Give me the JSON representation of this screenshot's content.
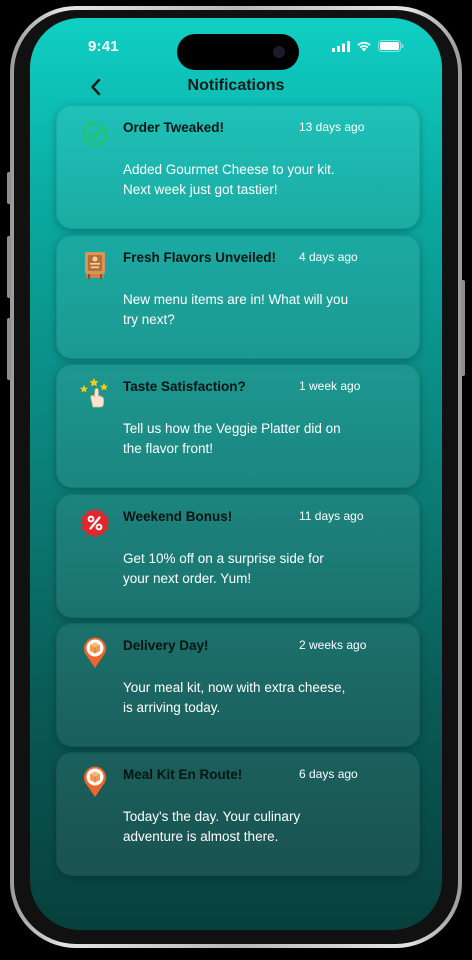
{
  "status_bar": {
    "time": "9:41"
  },
  "header": {
    "title": "Notifications"
  },
  "notifications": [
    {
      "title": "Order Tweaked!",
      "time": "13 days ago",
      "body": "Added Gourmet Cheese to your kit. Next week just got tastier!",
      "icon": "check-circle-icon"
    },
    {
      "title": "Fresh Flavors Unveiled!",
      "time": "4 days ago",
      "body": "New menu items are in! What will you try next?",
      "icon": "menu-board-icon"
    },
    {
      "title": "Taste Satisfaction?",
      "time": "1 week ago",
      "body": "Tell us how the Veggie Platter did on the flavor front!",
      "icon": "stars-rating-icon"
    },
    {
      "title": "Weekend Bonus!",
      "time": "11 days ago",
      "body": "Get 10% off on a surprise side for your next order. Yum!",
      "icon": "discount-badge-icon"
    },
    {
      "title": "Delivery Day!",
      "time": "2 weeks ago",
      "body": "Your meal kit, now with extra cheese, is arriving today.",
      "icon": "delivery-pin-icon"
    },
    {
      "title": "Meal Kit En Route!",
      "time": "6 days ago",
      "body": "Today's the day. Your culinary adventure is almost there.",
      "icon": "delivery-pin-icon"
    }
  ],
  "colors": {
    "gradient_top": "#10cfc4",
    "gradient_bottom": "#07403d",
    "check_green": "#22c55e",
    "discount_red": "#e3262b",
    "pin_orange": "#f0662a"
  }
}
